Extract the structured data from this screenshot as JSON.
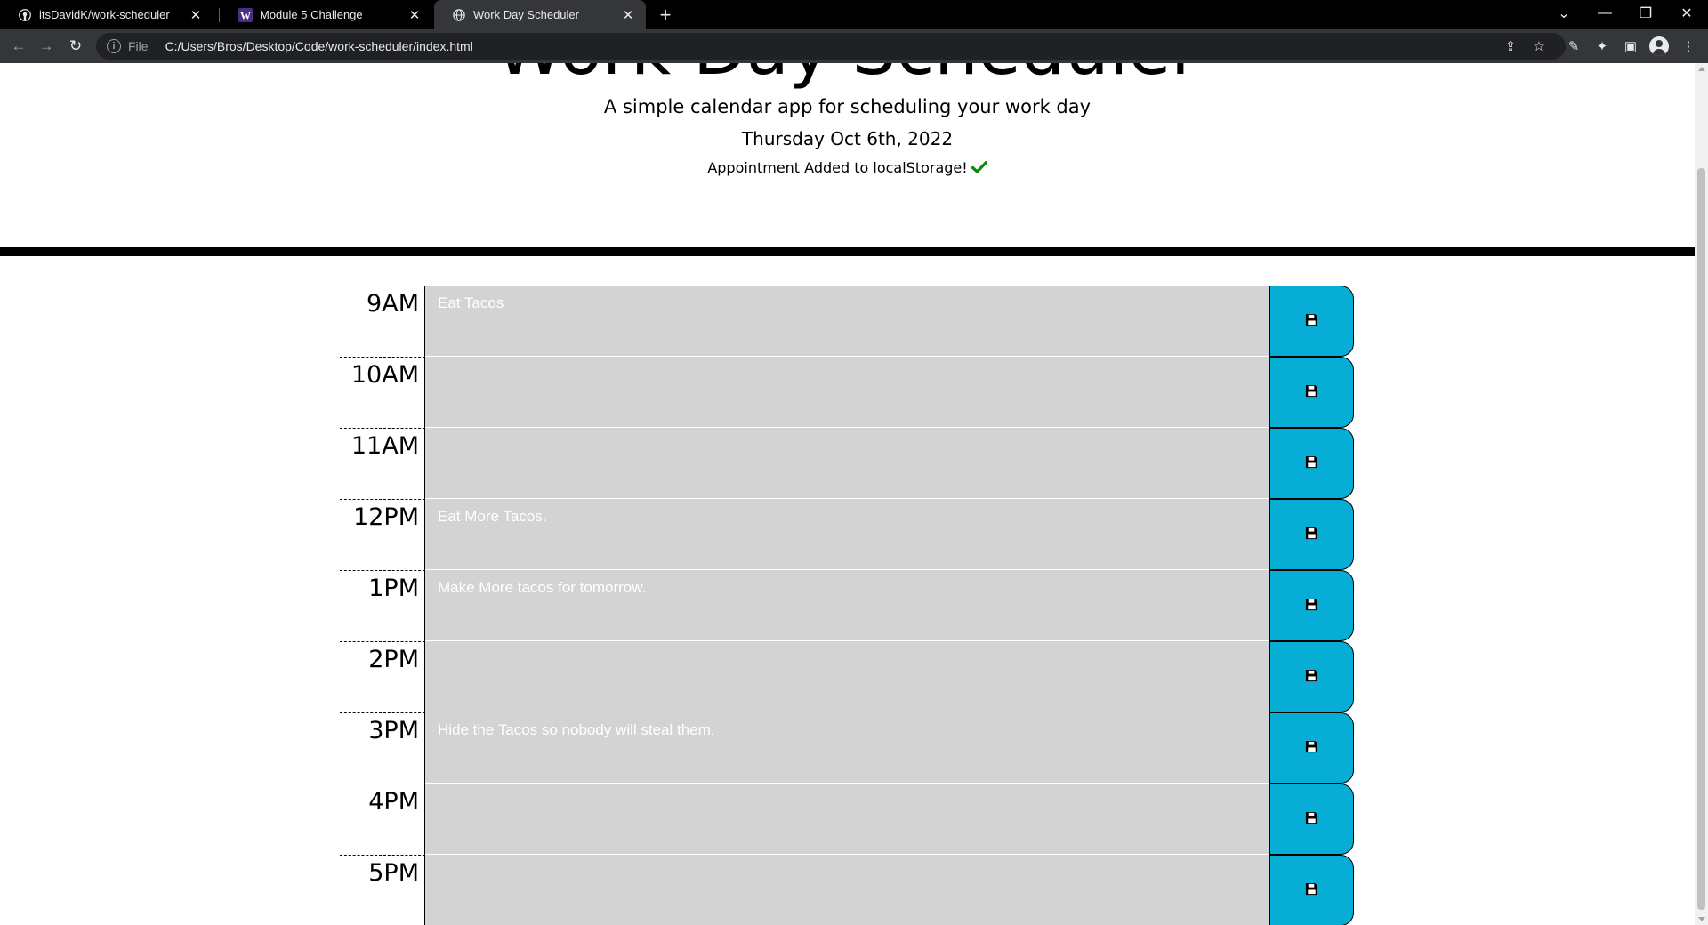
{
  "browser": {
    "tabs": [
      {
        "title": "itsDavidK/work-scheduler",
        "icon": "github-icon",
        "active": false
      },
      {
        "title": "Module 5 Challenge",
        "icon": "w-logo-icon",
        "active": false
      },
      {
        "title": "Work Day Scheduler",
        "icon": "globe-icon",
        "active": true
      }
    ],
    "address": {
      "scheme": "File",
      "url": "C:/Users/Bros/Desktop/Code/work-scheduler/index.html"
    }
  },
  "page": {
    "title": "Work Day Scheduler",
    "lead": "A simple calendar app for scheduling your work day",
    "date": "Thursday Oct 6th, 2022",
    "notice": "Appointment Added to localStorage!"
  },
  "colors": {
    "save_button": "#06aed5",
    "textarea_bg": "#d3d3d3",
    "check": "#0a8a0a"
  },
  "schedule": [
    {
      "hour": "9AM",
      "text": "Eat Tacos"
    },
    {
      "hour": "10AM",
      "text": ""
    },
    {
      "hour": "11AM",
      "text": ""
    },
    {
      "hour": "12PM",
      "text": "Eat More Tacos."
    },
    {
      "hour": "1PM",
      "text": "Make More tacos for tomorrow."
    },
    {
      "hour": "2PM",
      "text": ""
    },
    {
      "hour": "3PM",
      "text": "Hide the Tacos so nobody will steal them."
    },
    {
      "hour": "4PM",
      "text": ""
    },
    {
      "hour": "5PM",
      "text": ""
    }
  ]
}
